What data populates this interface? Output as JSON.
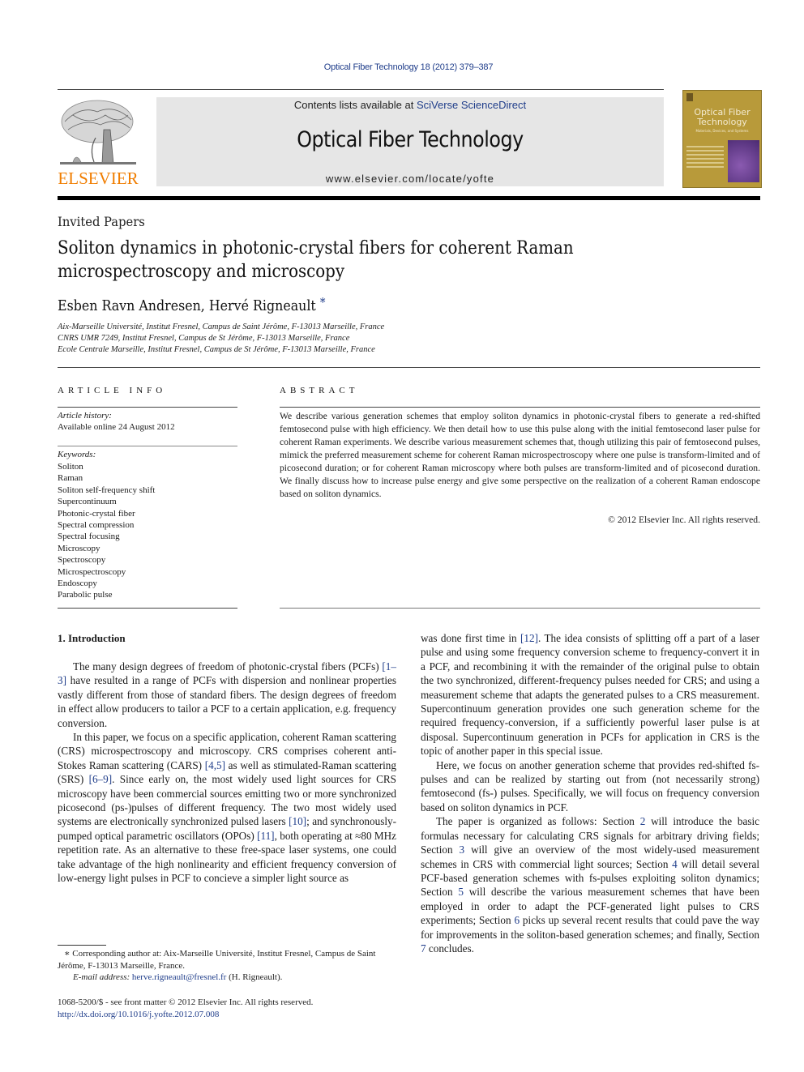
{
  "header": {
    "journal_ref": "Optical Fiber Technology 18 (2012) 379–387",
    "contents_prefix": "Contents lists available at ",
    "contents_link": "SciVerse ScienceDirect",
    "journal_title": "Optical Fiber Technology",
    "journal_url": "www.elsevier.com/locate/yofte",
    "publisher": "ELSEVIER",
    "cover_title": "Optical Fiber Technology",
    "cover_subtitle": "Materials, Devices, and Systems"
  },
  "article": {
    "section_type": "Invited Papers",
    "title": "Soliton dynamics in photonic-crystal fibers for coherent Raman microspectroscopy and microscopy",
    "authors": "Esben Ravn Andresen, Hervé Rigneault",
    "corresponding_mark": "*",
    "affiliations": [
      "Aix-Marseille Université, Institut Fresnel, Campus de Saint Jérôme, F-13013 Marseille, France",
      "CNRS UMR 7249, Institut Fresnel, Campus de St Jérôme, F-13013 Marseille, France",
      "Ecole Centrale Marseille, Institut Fresnel, Campus de St Jérôme, F-13013 Marseille, France"
    ]
  },
  "article_info": {
    "heading": "ARTICLE INFO",
    "history_label": "Article history:",
    "history_value": "Available online 24 August 2012",
    "keywords_label": "Keywords:",
    "keywords": [
      "Soliton",
      "Raman",
      "Soliton self-frequency shift",
      "Supercontinuum",
      "Photonic-crystal fiber",
      "Spectral compression",
      "Spectral focusing",
      "Microscopy",
      "Spectroscopy",
      "Microspectroscopy",
      "Endoscopy",
      "Parabolic pulse"
    ]
  },
  "abstract": {
    "heading": "ABSTRACT",
    "text": "We describe various generation schemes that employ soliton dynamics in photonic-crystal fibers to generate a red-shifted femtosecond pulse with high efficiency. We then detail how to use this pulse along with the initial femtosecond laser pulse for coherent Raman experiments. We describe various measurement schemes that, though utilizing this pair of femtosecond pulses, mimick the preferred measurement scheme for coherent Raman microspectroscopy where one pulse is transform-limited and of picosecond duration; or for coherent Raman microscopy where both pulses are transform-limited and of picosecond duration. We finally discuss how to increase pulse energy and give some perspective on the realization of a coherent Raman endoscope based on soliton dynamics.",
    "copyright": "© 2012 Elsevier Inc. All rights reserved."
  },
  "body": {
    "intro_heading": "1. Introduction",
    "left_paragraphs": [
      [
        {
          "t": "The many design degrees of freedom of photonic-crystal fibers (PCFs) "
        },
        {
          "t": "[1–3]",
          "link": true
        },
        {
          "t": " have resulted in a range of PCFs with dispersion and nonlinear properties vastly different from those of standard fibers. The design degrees of freedom in effect allow producers to tailor a PCF to a certain application, e.g. frequency conversion."
        }
      ],
      [
        {
          "t": "In this paper, we focus on a specific application, coherent Raman scattering (CRS) microspectroscopy and microscopy. CRS comprises coherent anti-Stokes Raman scattering (CARS) "
        },
        {
          "t": "[4,5]",
          "link": true
        },
        {
          "t": " as well as stimulated-Raman scattering (SRS) "
        },
        {
          "t": "[6–9]",
          "link": true
        },
        {
          "t": ". Since early on, the most widely used light sources for CRS microscopy have been commercial sources emitting two or more synchronized picosecond (ps-)pulses of different frequency. The two most widely used systems are electronically synchronized pulsed lasers "
        },
        {
          "t": "[10]",
          "link": true
        },
        {
          "t": "; and synchronously-pumped optical parametric oscillators (OPOs) "
        },
        {
          "t": "[11]",
          "link": true
        },
        {
          "t": ", both operating at ≈80 MHz repetition rate. As an alternative to these free-space laser systems, one could take advantage of the high nonlinearity and efficient frequency conversion of low-energy light pulses in PCF to concieve a simpler light source as"
        }
      ]
    ],
    "right_paragraphs": [
      [
        {
          "t": "was done first time in "
        },
        {
          "t": "[12]",
          "link": true
        },
        {
          "t": ". The idea consists of splitting off a part of a laser pulse and using some frequency conversion scheme to frequency-convert it in a PCF, and recombining it with the remainder of the original pulse to obtain the two synchronized, different-frequency pulses needed for CRS; and using a measurement scheme that adapts the generated pulses to a CRS measurement. Supercontinuum generation provides one such generation scheme for the required frequency-conversion, if a sufficiently powerful laser pulse is at disposal. Supercontinuum generation in PCFs for application in CRS is the topic of another paper in this special issue."
        }
      ],
      [
        {
          "t": "Here, we focus on another generation scheme that provides red-shifted fs-pulses and can be realized by starting out from (not necessarily strong) femtosecond (fs-) pulses. Specifically, we will focus on frequency conversion based on soliton dynamics in PCF."
        }
      ],
      [
        {
          "t": "The paper is organized as follows: Section "
        },
        {
          "t": "2",
          "link": true
        },
        {
          "t": " will introduce the basic formulas necessary for calculating CRS signals for arbitrary driving fields; Section "
        },
        {
          "t": "3",
          "link": true
        },
        {
          "t": " will give an overview of the most widely-used measurement schemes in CRS with commercial light sources; Section "
        },
        {
          "t": "4",
          "link": true
        },
        {
          "t": " will detail several PCF-based generation schemes with fs-pulses exploiting soliton dynamics; Section "
        },
        {
          "t": "5",
          "link": true
        },
        {
          "t": " will describe the various measurement schemes that have been employed in order to adapt the PCF-generated light pulses to CRS experiments; Section "
        },
        {
          "t": "6",
          "link": true
        },
        {
          "t": " picks up several recent results that could pave the way for improvements in the soliton-based generation schemes; and finally, Section "
        },
        {
          "t": "7",
          "link": true
        },
        {
          "t": " concludes."
        }
      ]
    ]
  },
  "footnote": {
    "corresponding": "∗ Corresponding author at: Aix-Marseille Université, Institut Fresnel, Campus de Saint Jérôme, F-13013 Marseille, France.",
    "email_label": "E-mail address:",
    "email": "herve.rigneault@fresnel.fr",
    "email_suffix": " (H. Rigneault).",
    "issn": "1068-5200/$ - see front matter © 2012 Elsevier Inc. All rights reserved.",
    "doi": "http://dx.doi.org/10.1016/j.yofte.2012.07.008"
  },
  "colors": {
    "link": "#1f3d8a",
    "elsevier_orange": "#f07d00",
    "banner_gray": "#e6e6e6",
    "cover_gold": "#b89a3a"
  }
}
